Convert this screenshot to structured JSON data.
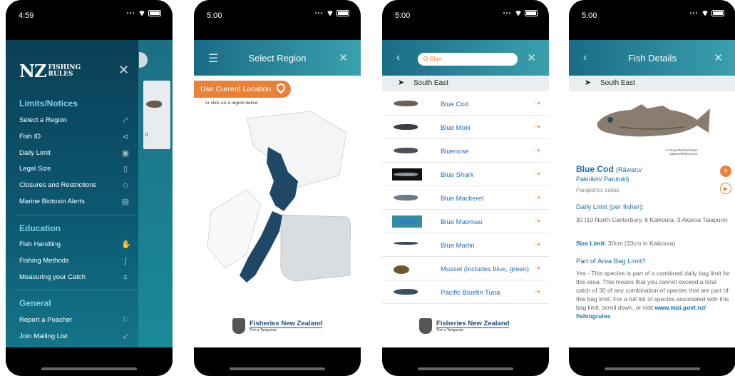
{
  "colors": {
    "teal": "#1a6c86",
    "orange": "#e8823a",
    "link": "#1e6fc0"
  },
  "phone1": {
    "time": "4:59",
    "logo": {
      "nz": "NZ",
      "fishing": "FISHING",
      "rules": "RULES"
    },
    "peek_link": "d",
    "sections": [
      {
        "title": "Limits/Notices",
        "items": [
          {
            "label": "Select a Region",
            "icon": "pin-icon"
          },
          {
            "label": "Fish ID",
            "icon": "fish-icon"
          },
          {
            "label": "Daily Limit",
            "icon": "calendar-icon"
          },
          {
            "label": "Legal Size",
            "icon": "ruler-icon"
          },
          {
            "label": "Closures and Restrictions",
            "icon": "warning-icon"
          },
          {
            "label": "Marine Biotoxin Alerts",
            "icon": "list-icon"
          }
        ]
      },
      {
        "title": "Education",
        "items": [
          {
            "label": "Fish Handling",
            "icon": "hand-icon"
          },
          {
            "label": "Fishing Methods",
            "icon": "hook-icon"
          },
          {
            "label": "Measuring your Catch",
            "icon": "measure-icon"
          }
        ]
      },
      {
        "title": "General",
        "items": [
          {
            "label": "Report a Poacher",
            "icon": "flag-icon"
          },
          {
            "label": "Join Mailing List",
            "icon": "send-icon"
          }
        ]
      }
    ]
  },
  "phone2": {
    "time": "5:00",
    "title": "Select Region",
    "use_location": "Use Current Location",
    "or_click": "or click on a region below",
    "footer_name": "Fisheries New Zealand",
    "footer_sub": "Tini a Tangaroa"
  },
  "phone3": {
    "time": "5:00",
    "search_value": "Blue",
    "region": "South East",
    "results": [
      {
        "name": "Blue Cod",
        "color": "#6b6158"
      },
      {
        "name": "Blue Moki",
        "color": "#3b3f44"
      },
      {
        "name": "Bluenose",
        "color": "#4a5058"
      },
      {
        "name": "Blue  Shark",
        "color": "#8c98a0"
      },
      {
        "name": "Blue Mackerel",
        "color": "#6c7b88"
      },
      {
        "name": "Blue Maomao",
        "color": "#2a86b8"
      },
      {
        "name": "Blue Marlin",
        "color": "#3a4658"
      },
      {
        "name": "Mussel (includes blue, green)",
        "color": "#6a5a2a"
      },
      {
        "name": "Pacific Bluefin Tuna",
        "color": "#3a4f6a"
      }
    ],
    "footer_name": "Fisheries New Zealand",
    "footer_sub": "Tini a Tangaroa"
  },
  "phone4": {
    "time": "5:00",
    "title": "Fish Details",
    "region": "South East",
    "photo_credit": "© Terry Wenford Hann",
    "photo_credit2": "www.nzfishes.co.nz",
    "fish_name": "Blue Cod",
    "maori_a": "(Rāwaru/",
    "maori_b": "Pakirikiri/ Patutuki)",
    "latin": "Parapercis colias",
    "daily_limit_heading": "Daily Limit (per fisher):",
    "daily_limit_text": "30 (10 North-Canterbury, 6 Kaikoura, 3 Akaroa Taiapure)",
    "size_limit_label": "Size Limit:",
    "size_limit_text": "30cm (33cm in Kaikoura)",
    "bag_heading": "Part of Area Bag Limit?",
    "bag_text": "Yes - This species is part of a combined daily bag limit for this area. This means that you cannot exceed a total catch of 30 of any combination of species that are part of this bag limit. For a full list of species associated with this bag limit, scroll down, or visit",
    "bag_link": "www.mpi.govt.nz/ fishingrules"
  }
}
